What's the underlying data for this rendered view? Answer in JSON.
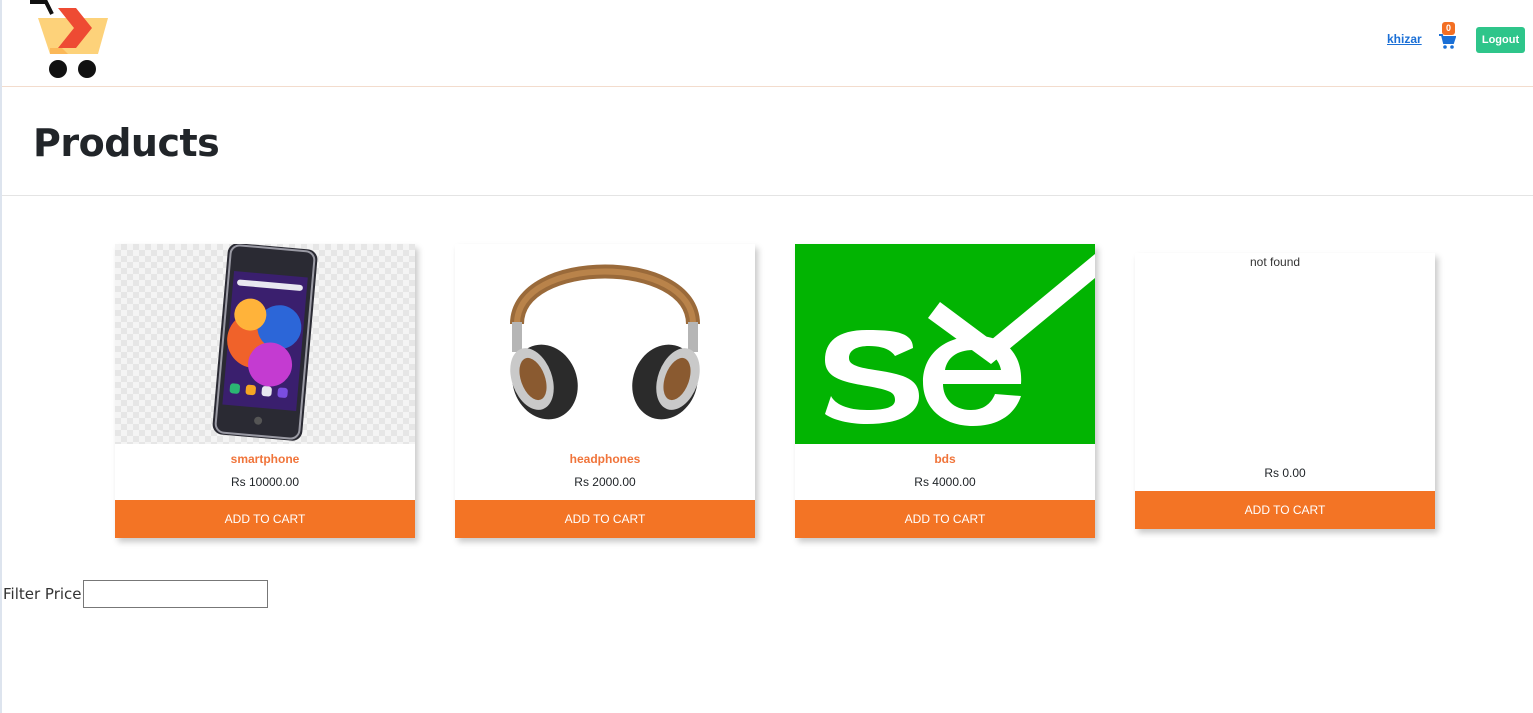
{
  "header": {
    "logo_icon": "shopping-cart-logo",
    "user_name": "khizar",
    "cart_count": "0",
    "cart_icon": "cart-icon",
    "logout_label": "Logout"
  },
  "page": {
    "title": "Products"
  },
  "products": [
    {
      "name": "smartphone",
      "price": "Rs 10000.00",
      "button": "ADD TO CART",
      "image": "smartphone"
    },
    {
      "name": "headphones",
      "price": "Rs 2000.00",
      "button": "ADD TO CART",
      "image": "headphones"
    },
    {
      "name": "bds",
      "price": "Rs 4000.00",
      "button": "ADD TO CART",
      "image": "selenium-logo"
    },
    {
      "name": "",
      "price": "Rs 0.00",
      "button": "ADD TO CART",
      "image_alt": "not found"
    }
  ],
  "filter": {
    "label": "Filter Price :",
    "value": ""
  },
  "colors": {
    "accent": "#f37425",
    "logout": "#2ec58a",
    "link": "#1a6fd6",
    "product_name": "#f0743a"
  }
}
